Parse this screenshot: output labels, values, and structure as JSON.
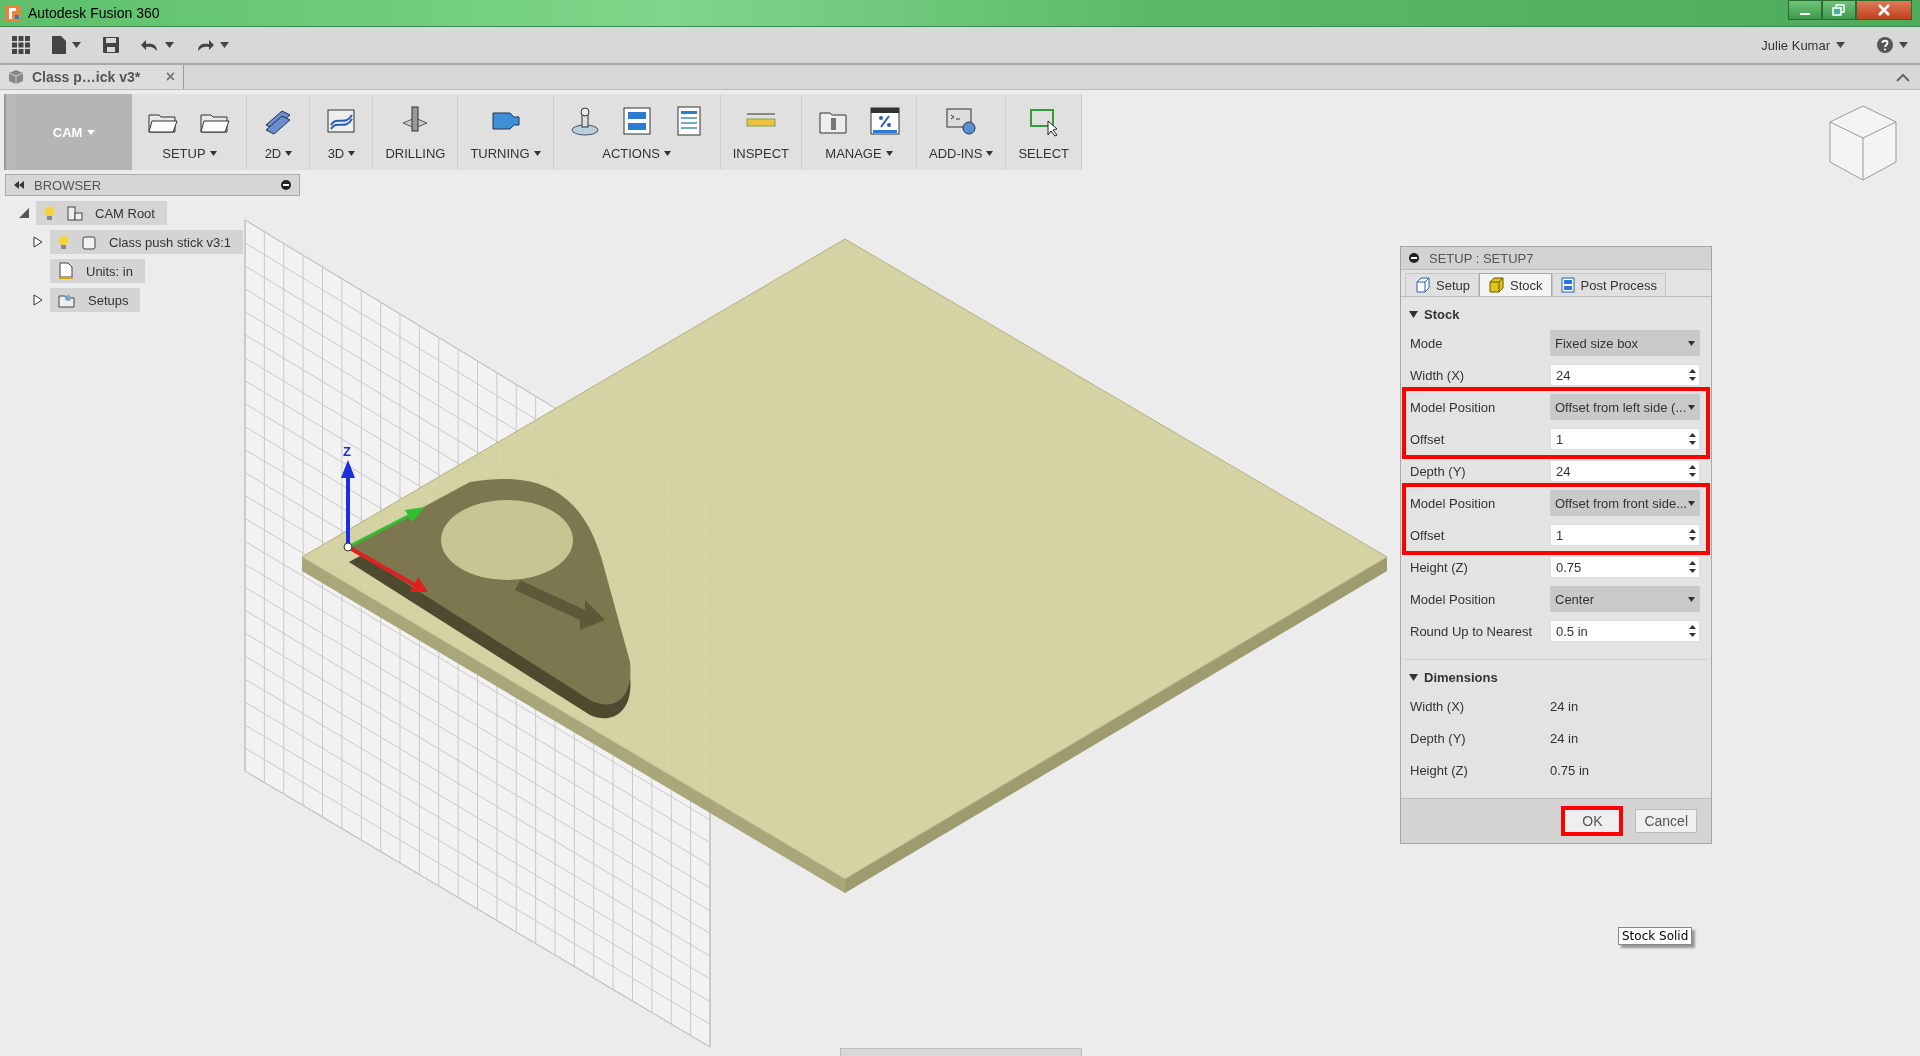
{
  "window": {
    "title": "Autodesk Fusion 360"
  },
  "app_bar": {
    "user": "Julie Kumar"
  },
  "document_tab": {
    "title": "Class p…ick v3*",
    "close": "×"
  },
  "toolbar": {
    "workspace": "CAM",
    "groups": [
      {
        "kind": "setup",
        "label": "SETUP",
        "has_menu": true
      },
      {
        "kind": "planar",
        "label": "2D",
        "has_menu": true
      },
      {
        "kind": "contour",
        "label": "3D",
        "has_menu": true
      },
      {
        "kind": "drilling",
        "label": "DRILLING",
        "has_menu": false
      },
      {
        "kind": "turning",
        "label": "TURNING",
        "has_menu": true
      },
      {
        "kind": "actions",
        "label": "ACTIONS",
        "has_menu": true
      },
      {
        "kind": "inspect",
        "label": "INSPECT",
        "has_menu": false
      },
      {
        "kind": "manage",
        "label": "MANAGE",
        "has_menu": true
      },
      {
        "kind": "addins",
        "label": "ADD-INS",
        "has_menu": true
      },
      {
        "kind": "select",
        "label": "SELECT",
        "has_menu": false
      }
    ]
  },
  "browser": {
    "title": "BROWSER",
    "tree": [
      {
        "label": "CAM Root",
        "kind": "root",
        "visible": true,
        "expanded": true,
        "children": [
          {
            "label": "Class push stick v3:1",
            "kind": "component",
            "visible": true,
            "expanded": false
          },
          {
            "label": "Units: in",
            "kind": "units"
          },
          {
            "label": "Setups",
            "kind": "folder",
            "expanded": false
          }
        ]
      }
    ]
  },
  "viewport": {
    "axis_label": "Z",
    "tooltip": "Stock Solid"
  },
  "dialog": {
    "title": "SETUP : SETUP7",
    "tabs": [
      {
        "label": "Setup",
        "kind": "setup",
        "selected": false
      },
      {
        "label": "Stock",
        "kind": "stock",
        "selected": true
      },
      {
        "label": "Post Process",
        "kind": "post",
        "selected": false
      }
    ],
    "sections": [
      {
        "title": "Stock",
        "expanded": true,
        "groups": [
          {
            "highlighted": false,
            "rows": [
              {
                "label": "Mode",
                "kind": "dropdown",
                "value": "Fixed size box"
              },
              {
                "label": "Width (X)",
                "kind": "spinner",
                "value": "24"
              }
            ]
          },
          {
            "highlighted": true,
            "rows": [
              {
                "label": "Model Position",
                "kind": "dropdown",
                "value": "Offset from left side (..."
              },
              {
                "label": "Offset",
                "kind": "spinner",
                "value": "1"
              }
            ]
          },
          {
            "highlighted": false,
            "rows": [
              {
                "label": "Depth (Y)",
                "kind": "spinner",
                "value": "24"
              }
            ]
          },
          {
            "highlighted": true,
            "rows": [
              {
                "label": "Model Position",
                "kind": "dropdown",
                "value": "Offset from front side..."
              },
              {
                "label": "Offset",
                "kind": "spinner",
                "value": "1"
              }
            ]
          },
          {
            "highlighted": false,
            "rows": [
              {
                "label": "Height (Z)",
                "kind": "spinner",
                "value": "0.75"
              },
              {
                "label": "Model Position",
                "kind": "dropdown",
                "value": "Center"
              },
              {
                "label": "Round Up to Nearest",
                "kind": "spinner",
                "value": "0.5 in"
              }
            ]
          }
        ]
      },
      {
        "title": "Dimensions",
        "expanded": true,
        "groups": [
          {
            "highlighted": false,
            "rows": [
              {
                "label": "Width (X)",
                "kind": "readout",
                "value": "24 in"
              },
              {
                "label": "Depth (Y)",
                "kind": "readout",
                "value": "24 in"
              },
              {
                "label": "Height (Z)",
                "kind": "readout",
                "value": "0.75 in"
              }
            ]
          }
        ]
      }
    ],
    "buttons": [
      {
        "label": "OK",
        "highlighted": true
      },
      {
        "label": "Cancel",
        "highlighted": false
      }
    ]
  }
}
